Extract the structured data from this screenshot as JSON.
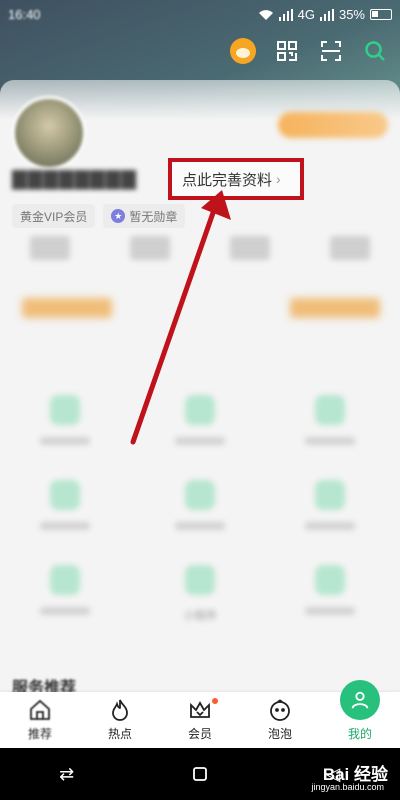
{
  "status_bar": {
    "time": "16:40",
    "network": "4G",
    "battery": "35%"
  },
  "top_icons": [
    "mascot-icon",
    "qr-code-icon",
    "scan-icon",
    "search-icon"
  ],
  "profile": {
    "complete_profile_label": "点此完善资料",
    "chevron": "›",
    "badges": [
      {
        "label": "黄金VIP会员"
      },
      {
        "label": "暂无勋章"
      }
    ]
  },
  "grid_partial_label": "小程序",
  "section": {
    "title": "服务推荐"
  },
  "bottom_nav": [
    {
      "label": "推荐",
      "icon": "home-icon"
    },
    {
      "label": "热点",
      "icon": "fire-icon"
    },
    {
      "label": "会员",
      "icon": "crown-icon",
      "dot": true
    },
    {
      "label": "泡泡",
      "icon": "bubble-icon"
    },
    {
      "label": "我的",
      "icon": "user-icon",
      "active": true
    }
  ],
  "watermark": {
    "brand": "Bai 经验",
    "url": "jingyan.baidu.com"
  },
  "colors": {
    "accent": "#27c07c",
    "annotation": "#c0121a"
  }
}
